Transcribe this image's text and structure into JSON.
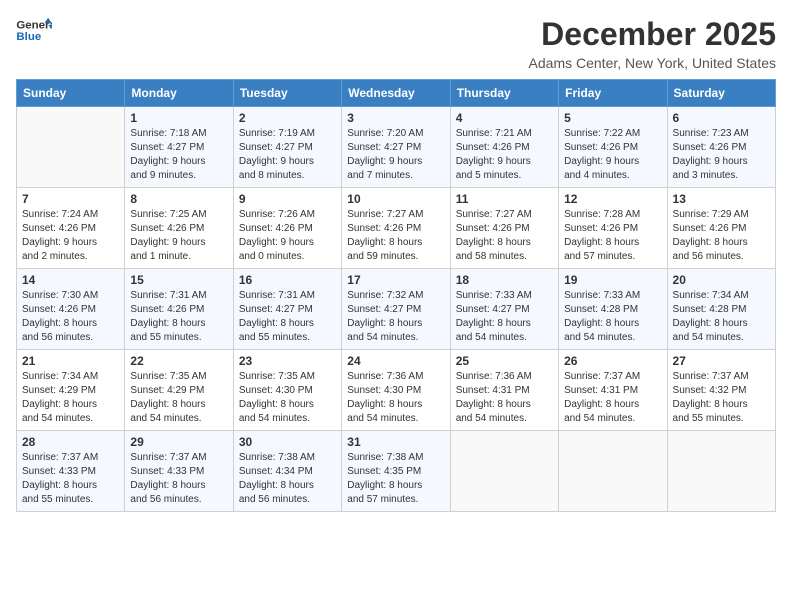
{
  "logo": {
    "line1": "General",
    "line2": "Blue"
  },
  "title": "December 2025",
  "subtitle": "Adams Center, New York, United States",
  "days_header": [
    "Sunday",
    "Monday",
    "Tuesday",
    "Wednesday",
    "Thursday",
    "Friday",
    "Saturday"
  ],
  "weeks": [
    [
      {
        "day": "",
        "info": ""
      },
      {
        "day": "1",
        "info": "Sunrise: 7:18 AM\nSunset: 4:27 PM\nDaylight: 9 hours\nand 9 minutes."
      },
      {
        "day": "2",
        "info": "Sunrise: 7:19 AM\nSunset: 4:27 PM\nDaylight: 9 hours\nand 8 minutes."
      },
      {
        "day": "3",
        "info": "Sunrise: 7:20 AM\nSunset: 4:27 PM\nDaylight: 9 hours\nand 7 minutes."
      },
      {
        "day": "4",
        "info": "Sunrise: 7:21 AM\nSunset: 4:26 PM\nDaylight: 9 hours\nand 5 minutes."
      },
      {
        "day": "5",
        "info": "Sunrise: 7:22 AM\nSunset: 4:26 PM\nDaylight: 9 hours\nand 4 minutes."
      },
      {
        "day": "6",
        "info": "Sunrise: 7:23 AM\nSunset: 4:26 PM\nDaylight: 9 hours\nand 3 minutes."
      }
    ],
    [
      {
        "day": "7",
        "info": "Sunrise: 7:24 AM\nSunset: 4:26 PM\nDaylight: 9 hours\nand 2 minutes."
      },
      {
        "day": "8",
        "info": "Sunrise: 7:25 AM\nSunset: 4:26 PM\nDaylight: 9 hours\nand 1 minute."
      },
      {
        "day": "9",
        "info": "Sunrise: 7:26 AM\nSunset: 4:26 PM\nDaylight: 9 hours\nand 0 minutes."
      },
      {
        "day": "10",
        "info": "Sunrise: 7:27 AM\nSunset: 4:26 PM\nDaylight: 8 hours\nand 59 minutes."
      },
      {
        "day": "11",
        "info": "Sunrise: 7:27 AM\nSunset: 4:26 PM\nDaylight: 8 hours\nand 58 minutes."
      },
      {
        "day": "12",
        "info": "Sunrise: 7:28 AM\nSunset: 4:26 PM\nDaylight: 8 hours\nand 57 minutes."
      },
      {
        "day": "13",
        "info": "Sunrise: 7:29 AM\nSunset: 4:26 PM\nDaylight: 8 hours\nand 56 minutes."
      }
    ],
    [
      {
        "day": "14",
        "info": "Sunrise: 7:30 AM\nSunset: 4:26 PM\nDaylight: 8 hours\nand 56 minutes."
      },
      {
        "day": "15",
        "info": "Sunrise: 7:31 AM\nSunset: 4:26 PM\nDaylight: 8 hours\nand 55 minutes."
      },
      {
        "day": "16",
        "info": "Sunrise: 7:31 AM\nSunset: 4:27 PM\nDaylight: 8 hours\nand 55 minutes."
      },
      {
        "day": "17",
        "info": "Sunrise: 7:32 AM\nSunset: 4:27 PM\nDaylight: 8 hours\nand 54 minutes."
      },
      {
        "day": "18",
        "info": "Sunrise: 7:33 AM\nSunset: 4:27 PM\nDaylight: 8 hours\nand 54 minutes."
      },
      {
        "day": "19",
        "info": "Sunrise: 7:33 AM\nSunset: 4:28 PM\nDaylight: 8 hours\nand 54 minutes."
      },
      {
        "day": "20",
        "info": "Sunrise: 7:34 AM\nSunset: 4:28 PM\nDaylight: 8 hours\nand 54 minutes."
      }
    ],
    [
      {
        "day": "21",
        "info": "Sunrise: 7:34 AM\nSunset: 4:29 PM\nDaylight: 8 hours\nand 54 minutes."
      },
      {
        "day": "22",
        "info": "Sunrise: 7:35 AM\nSunset: 4:29 PM\nDaylight: 8 hours\nand 54 minutes."
      },
      {
        "day": "23",
        "info": "Sunrise: 7:35 AM\nSunset: 4:30 PM\nDaylight: 8 hours\nand 54 minutes."
      },
      {
        "day": "24",
        "info": "Sunrise: 7:36 AM\nSunset: 4:30 PM\nDaylight: 8 hours\nand 54 minutes."
      },
      {
        "day": "25",
        "info": "Sunrise: 7:36 AM\nSunset: 4:31 PM\nDaylight: 8 hours\nand 54 minutes."
      },
      {
        "day": "26",
        "info": "Sunrise: 7:37 AM\nSunset: 4:31 PM\nDaylight: 8 hours\nand 54 minutes."
      },
      {
        "day": "27",
        "info": "Sunrise: 7:37 AM\nSunset: 4:32 PM\nDaylight: 8 hours\nand 55 minutes."
      }
    ],
    [
      {
        "day": "28",
        "info": "Sunrise: 7:37 AM\nSunset: 4:33 PM\nDaylight: 8 hours\nand 55 minutes."
      },
      {
        "day": "29",
        "info": "Sunrise: 7:37 AM\nSunset: 4:33 PM\nDaylight: 8 hours\nand 56 minutes."
      },
      {
        "day": "30",
        "info": "Sunrise: 7:38 AM\nSunset: 4:34 PM\nDaylight: 8 hours\nand 56 minutes."
      },
      {
        "day": "31",
        "info": "Sunrise: 7:38 AM\nSunset: 4:35 PM\nDaylight: 8 hours\nand 57 minutes."
      },
      {
        "day": "",
        "info": ""
      },
      {
        "day": "",
        "info": ""
      },
      {
        "day": "",
        "info": ""
      }
    ]
  ]
}
